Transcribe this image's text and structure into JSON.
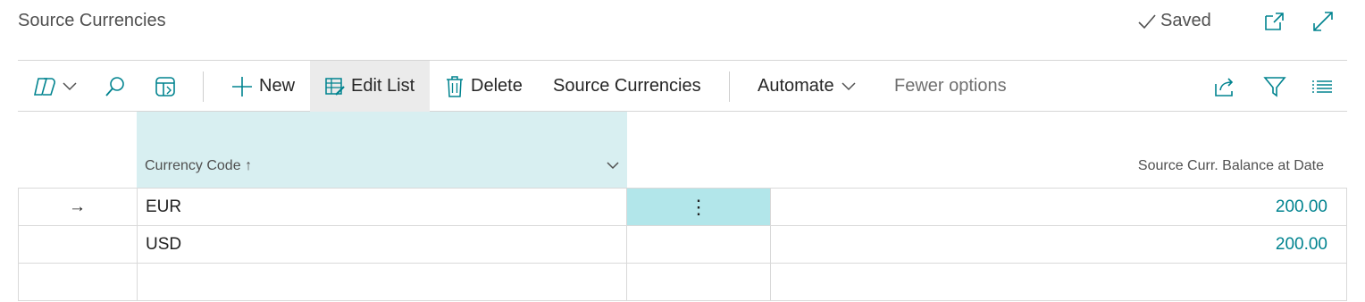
{
  "page": {
    "title": "Source Currencies",
    "saved_label": "Saved"
  },
  "toolbar": {
    "new_label": "New",
    "edit_list_label": "Edit List",
    "delete_label": "Delete",
    "source_currencies_label": "Source Currencies",
    "automate_label": "Automate",
    "fewer_options_label": "Fewer options"
  },
  "table": {
    "columns": {
      "currency_code": "Currency Code",
      "sort_indicator": "↑",
      "balance": "Source Curr. Balance at Date"
    },
    "rows": [
      {
        "selected_marker": "→",
        "currency_code": "EUR",
        "balance": "200.00"
      },
      {
        "selected_marker": "",
        "currency_code": "USD",
        "balance": "200.00"
      }
    ],
    "row_menu_glyph": "⋮"
  },
  "colors": {
    "accent": "#00838f",
    "header_highlight": "#d8eff1",
    "row_menu_highlight": "#b2e6ea",
    "active_button_bg": "#ebebeb"
  },
  "icons": [
    "copilot-icon",
    "chevron-down-icon",
    "search-icon",
    "analyze-icon",
    "plus-icon",
    "edit-list-icon",
    "trash-icon",
    "share-icon",
    "filter-icon",
    "list-icon",
    "open-new-window-icon",
    "expand-icon",
    "checkmark-icon"
  ]
}
